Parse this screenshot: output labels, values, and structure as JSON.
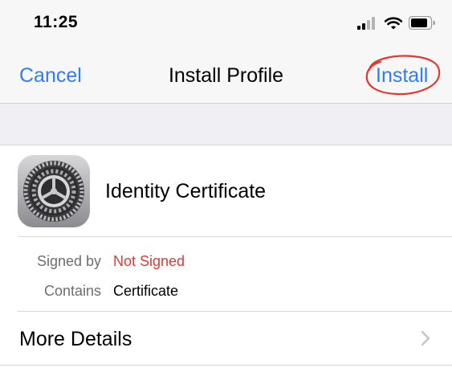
{
  "status_bar": {
    "time": "11:25",
    "icons": [
      "cellular-signal-icon",
      "wifi-icon",
      "battery-icon"
    ]
  },
  "nav": {
    "cancel_label": "Cancel",
    "title": "Install Profile",
    "install_label": "Install",
    "accent_color": "#2f7cf6",
    "annotation_color": "#e2382f"
  },
  "profile": {
    "icon": "settings-gear-icon",
    "name": "Identity Certificate",
    "signed_by_label": "Signed by",
    "signed_by_value": "Not Signed",
    "signed_by_color": "#e2382f",
    "contains_label": "Contains",
    "contains_value": "Certificate"
  },
  "more_details": {
    "label": "More Details",
    "icon": "chevron-right-icon"
  }
}
